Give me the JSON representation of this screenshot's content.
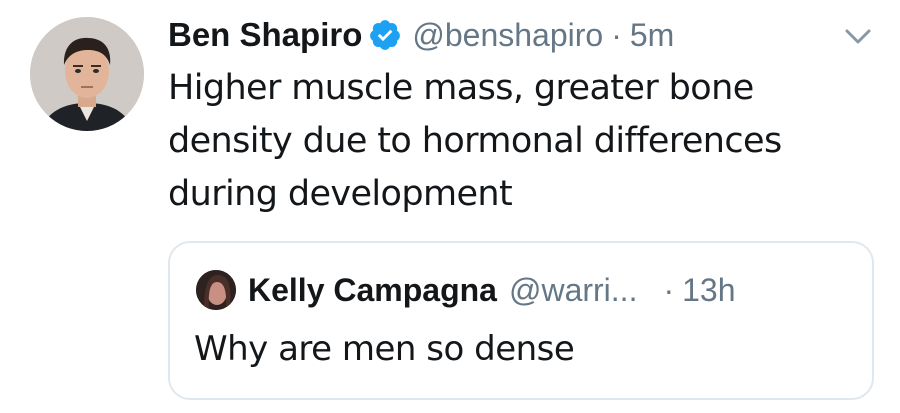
{
  "tweet": {
    "author": {
      "display_name": "Ben Shapiro",
      "handle": "@benshapiro",
      "verified": true,
      "avatar_icon": "profile-photo"
    },
    "separator": "·",
    "time": "5m",
    "text": "Higher muscle mass, greater bone density due to hormonal differences during development",
    "menu_icon": "chevron-down-icon"
  },
  "quoted_tweet": {
    "author": {
      "display_name": "Kelly Campagna",
      "handle": "@warri...",
      "avatar_icon": "profile-photo"
    },
    "separator": "·",
    "time": "13h",
    "text": "Why are men so dense"
  },
  "colors": {
    "text": "#14171a",
    "secondary": "#657786",
    "verified_blue": "#1da1f2",
    "border": "#e1e8ed"
  }
}
